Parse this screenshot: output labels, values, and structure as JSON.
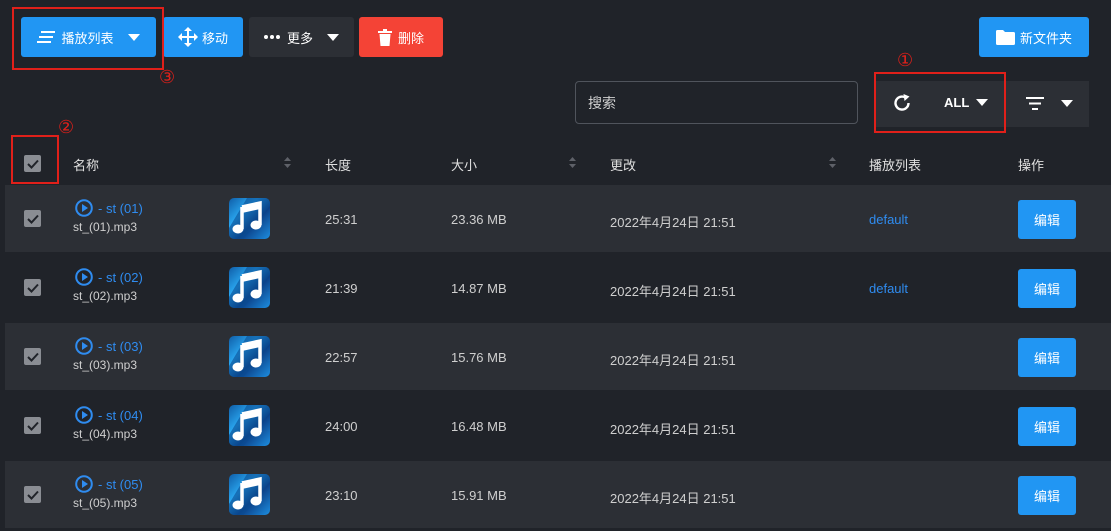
{
  "toolbar": {
    "playlist_label": "播放列表",
    "move_label": "移动",
    "more_label": "更多",
    "delete_label": "删除",
    "new_folder_label": "新文件夹"
  },
  "annotations": {
    "one": "①",
    "two": "②",
    "three": "③"
  },
  "search": {
    "placeholder": "搜索"
  },
  "filter": {
    "type_value": "ALL"
  },
  "columns": {
    "name": "名称",
    "length": "长度",
    "size": "大小",
    "modified": "更改",
    "playlist": "播放列表",
    "actions": "操作"
  },
  "rows": [
    {
      "title": "- st (01)",
      "filename": "st_(01).mp3",
      "length": "25:31",
      "size": "23.36 MB",
      "modified": "2022年4月24日 21:51",
      "playlist": "default",
      "edit": "编辑"
    },
    {
      "title": "- st (02)",
      "filename": "st_(02).mp3",
      "length": "21:39",
      "size": "14.87 MB",
      "modified": "2022年4月24日 21:51",
      "playlist": "default",
      "edit": "编辑"
    },
    {
      "title": "- st (03)",
      "filename": "st_(03).mp3",
      "length": "22:57",
      "size": "15.76 MB",
      "modified": "2022年4月24日 21:51",
      "playlist": "",
      "edit": "编辑"
    },
    {
      "title": "- st (04)",
      "filename": "st_(04).mp3",
      "length": "24:00",
      "size": "16.48 MB",
      "modified": "2022年4月24日 21:51",
      "playlist": "",
      "edit": "编辑"
    },
    {
      "title": "- st (05)",
      "filename": "st_(05).mp3",
      "length": "23:10",
      "size": "15.91 MB",
      "modified": "2022年4月24日 21:51",
      "playlist": "",
      "edit": "编辑"
    }
  ],
  "colors": {
    "background": "#202329",
    "row_alt": "#2c2f35",
    "accent": "#2196f3",
    "danger": "#f44336",
    "link": "#2f8cf0",
    "annotation": "#e0201a"
  },
  "icons": [
    "lines-icon",
    "move-arrows-icon",
    "more-dots-icon",
    "trash-icon",
    "folder-icon",
    "refresh-icon",
    "filter-icon",
    "caret-down-icon",
    "checkbox-icon",
    "play-circle-icon",
    "music-note-icon",
    "sort-icon"
  ]
}
